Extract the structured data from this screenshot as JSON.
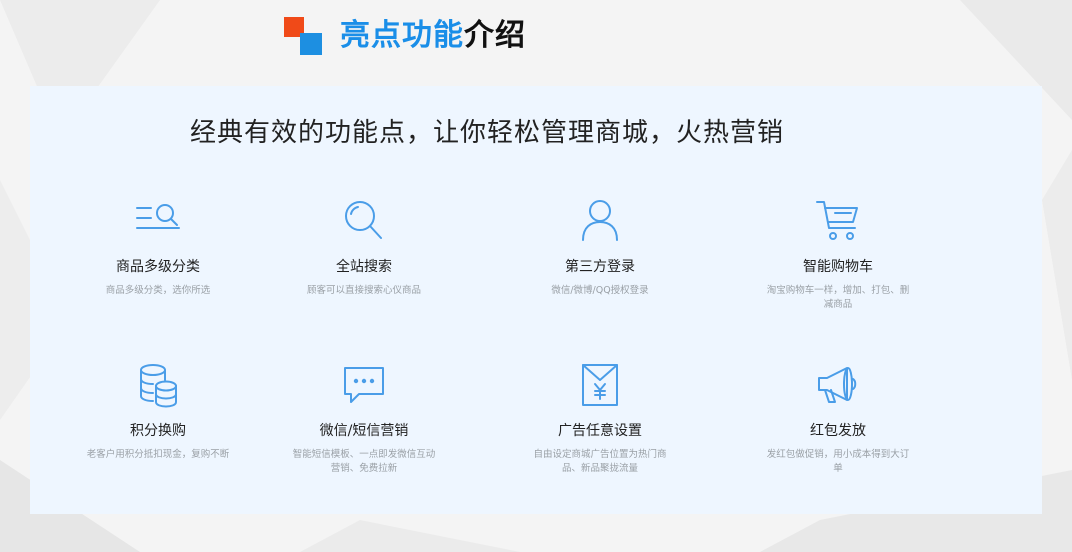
{
  "header": {
    "title_highlight": "亮点功能",
    "title_rest": "介绍"
  },
  "panel": {
    "subtitle": "经典有效的功能点，让你轻松管理商城，火热营销"
  },
  "features": [
    {
      "icon": "category-list-icon",
      "name": "商品多级分类",
      "desc": "商品多级分类，选你所选"
    },
    {
      "icon": "search-icon",
      "name": "全站搜索",
      "desc": "顾客可以直接搜索心仪商品"
    },
    {
      "icon": "user-icon",
      "name": "第三方登录",
      "desc": "微信/微博/QQ授权登录"
    },
    {
      "icon": "shopping-cart-icon",
      "name": "智能购物车",
      "desc": "淘宝购物车一样，增加、打包、删减商品"
    },
    {
      "icon": "coins-stack-icon",
      "name": "积分换购",
      "desc": "老客户用积分抵扣现金，复购不断"
    },
    {
      "icon": "chat-bubble-icon",
      "name": "微信/短信营销",
      "desc": "智能短信模板、一点即发微信互动营销、免费拉新"
    },
    {
      "icon": "ad-envelope-icon",
      "name": "广告任意设置",
      "desc": "自由设定商城广告位置为热门商品、新品聚拢流量"
    },
    {
      "icon": "megaphone-icon",
      "name": "红包发放",
      "desc": "发红包做促销，用小成本得到大订单"
    }
  ],
  "colors": {
    "accent_blue": "#1a8ee8",
    "accent_orange": "#f04a18",
    "icon_blue": "#4a9de8",
    "panel_bg": "#eef6ff"
  }
}
